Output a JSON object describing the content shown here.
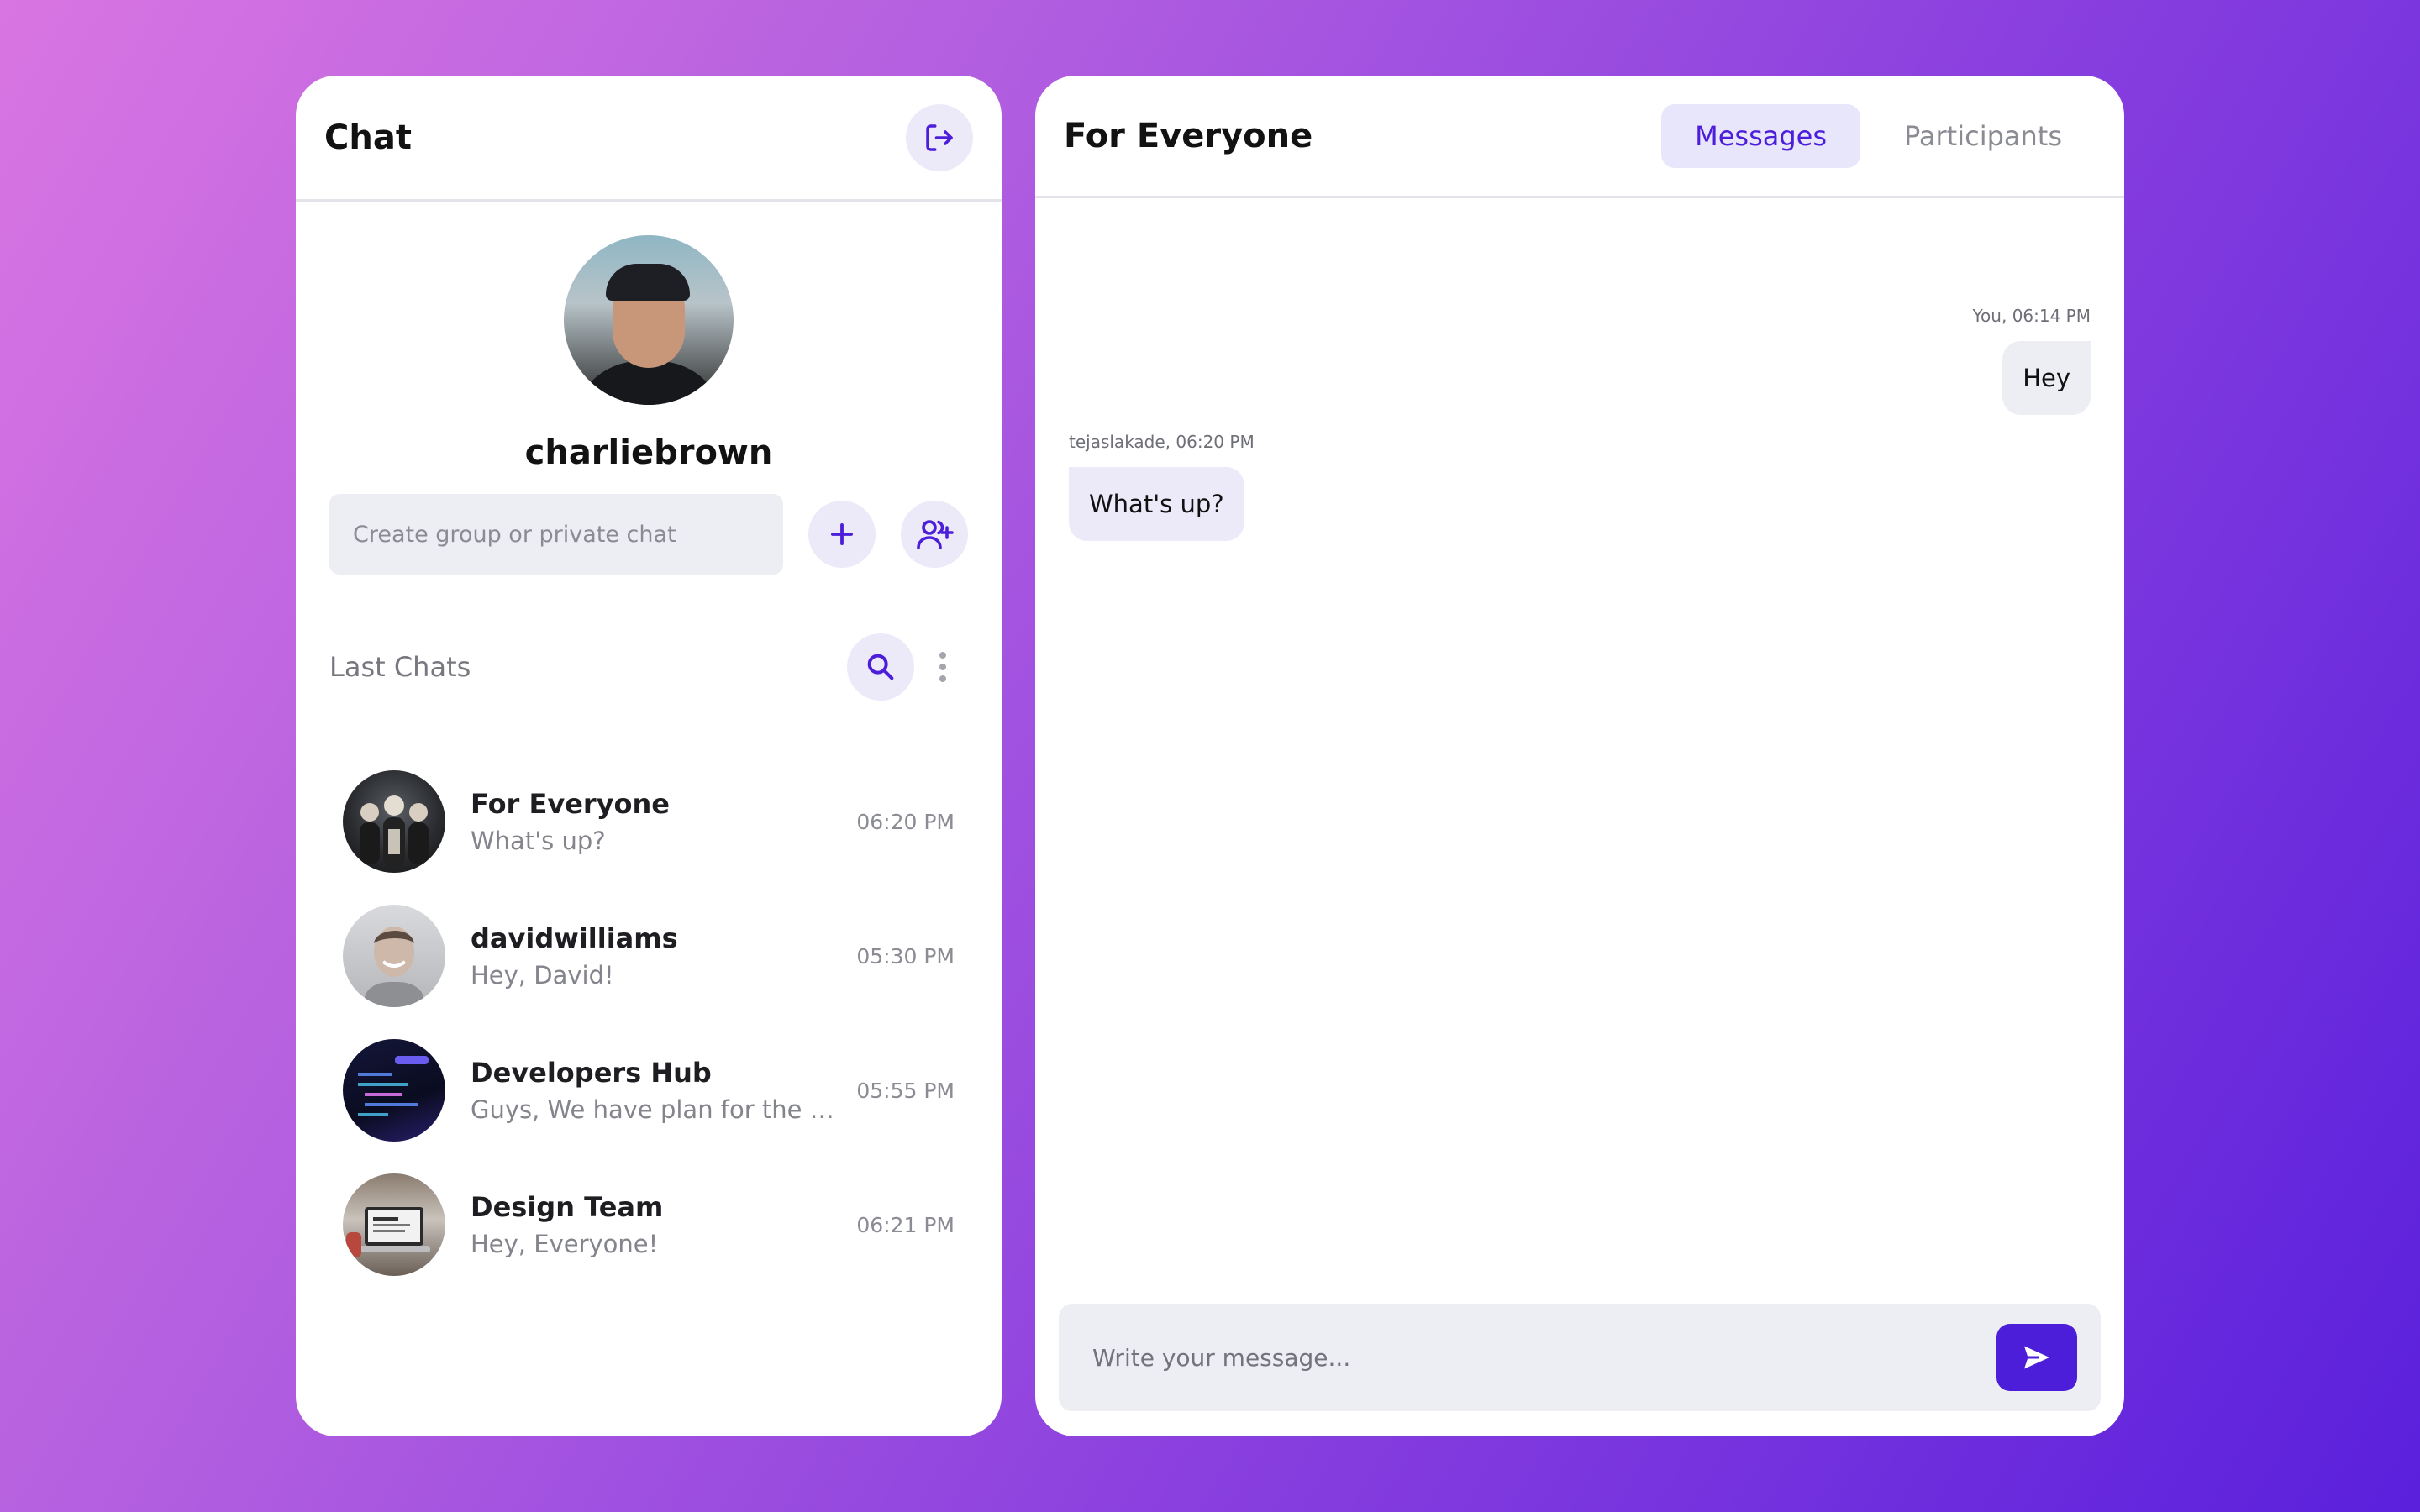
{
  "colors": {
    "accent": "#4c1ed9",
    "accent_soft": "#eceaf9",
    "input_bg": "#eceef3",
    "gradient_start": "#d975e2",
    "gradient_end": "#5a20dc"
  },
  "sidebar": {
    "title": "Chat",
    "logout_icon": "logout-icon",
    "profile": {
      "username": "charliebrown"
    },
    "create": {
      "placeholder": "Create group or private chat",
      "add_icon": "plus-icon",
      "add_user_icon": "add-user-icon"
    },
    "last_chats": {
      "label": "Last Chats",
      "search_icon": "search-icon",
      "menu_icon": "more-vertical-icon"
    },
    "chats": [
      {
        "name": "For Everyone",
        "preview": "What's up?",
        "time": "06:20 PM"
      },
      {
        "name": "davidwilliams",
        "preview": "Hey, David!",
        "time": "05:30 PM"
      },
      {
        "name": "Developers Hub",
        "preview": "Guys, We have plan for the next",
        "time": "05:55 PM"
      },
      {
        "name": "Design Team",
        "preview": "Hey, Everyone!",
        "time": "06:21 PM"
      }
    ]
  },
  "conversation": {
    "title": "For Everyone",
    "tabs": [
      {
        "label": "Messages",
        "active": true
      },
      {
        "label": "Participants",
        "active": false
      }
    ],
    "messages": [
      {
        "meta": "You, 06:14 PM",
        "text": "Hey",
        "own": true
      },
      {
        "meta": "tejaslakade, 06:20 PM",
        "text": "What's up?",
        "own": false
      }
    ],
    "composer": {
      "placeholder": "Write your message...",
      "send_icon": "send-icon"
    }
  }
}
